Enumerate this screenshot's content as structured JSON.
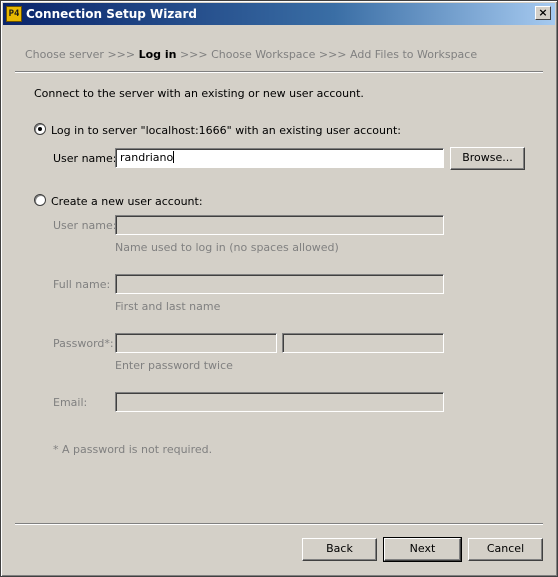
{
  "window": {
    "title": "Connection Setup Wizard",
    "app_icon": "p4-logo-icon",
    "close_icon": "close-icon",
    "close_glyph": "×"
  },
  "steps": [
    {
      "label": "Choose server",
      "active": false
    },
    {
      "label": "Log in",
      "active": true
    },
    {
      "label": "Choose Workspace",
      "active": false
    },
    {
      "label": "Add Files to Workspace",
      "active": false
    }
  ],
  "step_separator": ">>>",
  "intro": "Connect to the server with an existing or new user account.",
  "existing": {
    "radio_label": "Log in to server \"localhost:1666\" with an existing user account:",
    "selected": true,
    "username_label": "User name:",
    "username_value": "randriano",
    "browse_label": "Browse..."
  },
  "new_account": {
    "radio_label": "Create a new user account:",
    "selected": false,
    "username_label": "User name:",
    "username_hint": "Name used to log in (no spaces allowed)",
    "fullname_label": "Full name:",
    "fullname_hint": "First and last name",
    "password_label": "Password*:",
    "password_hint": "Enter password twice",
    "email_label": "Email:",
    "footnote": "* A password is not required."
  },
  "buttons": {
    "back": "Back",
    "next": "Next",
    "cancel": "Cancel"
  }
}
